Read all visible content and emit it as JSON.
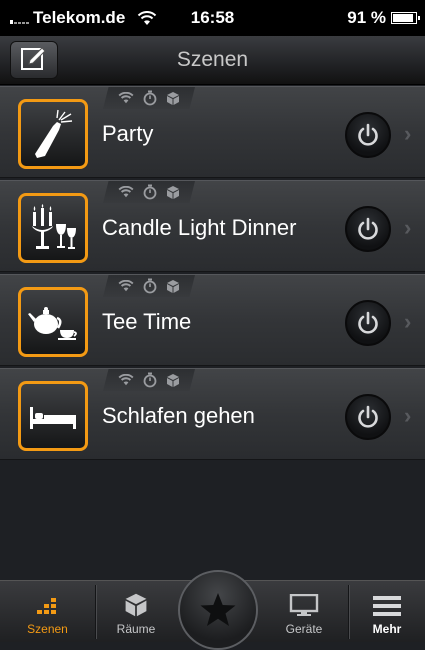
{
  "status_bar": {
    "carrier": "Telekom.de",
    "time": "16:58",
    "battery": "91 %",
    "battery_level": 0.91
  },
  "header": {
    "title": "Szenen",
    "edit_icon": "pencil-icon"
  },
  "scenes": [
    {
      "name": "Party",
      "icon": "champagne-bottle-icon"
    },
    {
      "name": "Candle Light Dinner",
      "icon": "candelabra-wine-icon"
    },
    {
      "name": "Tee Time",
      "icon": "teapot-cup-icon"
    },
    {
      "name": "Schlafen gehen",
      "icon": "bed-icon"
    }
  ],
  "tabs": [
    {
      "label": "Szenen",
      "icon": "scenes-grid-icon",
      "active": true
    },
    {
      "label": "Räume",
      "icon": "cube-icon",
      "active": false
    },
    {
      "label": "",
      "icon": "star-icon",
      "active": false
    },
    {
      "label": "Geräte",
      "icon": "monitor-icon",
      "active": false
    },
    {
      "label": "Mehr",
      "icon": "menu-lines-icon",
      "active": false
    }
  ],
  "colors": {
    "accent": "#f39a14",
    "background": "#1e2024"
  }
}
